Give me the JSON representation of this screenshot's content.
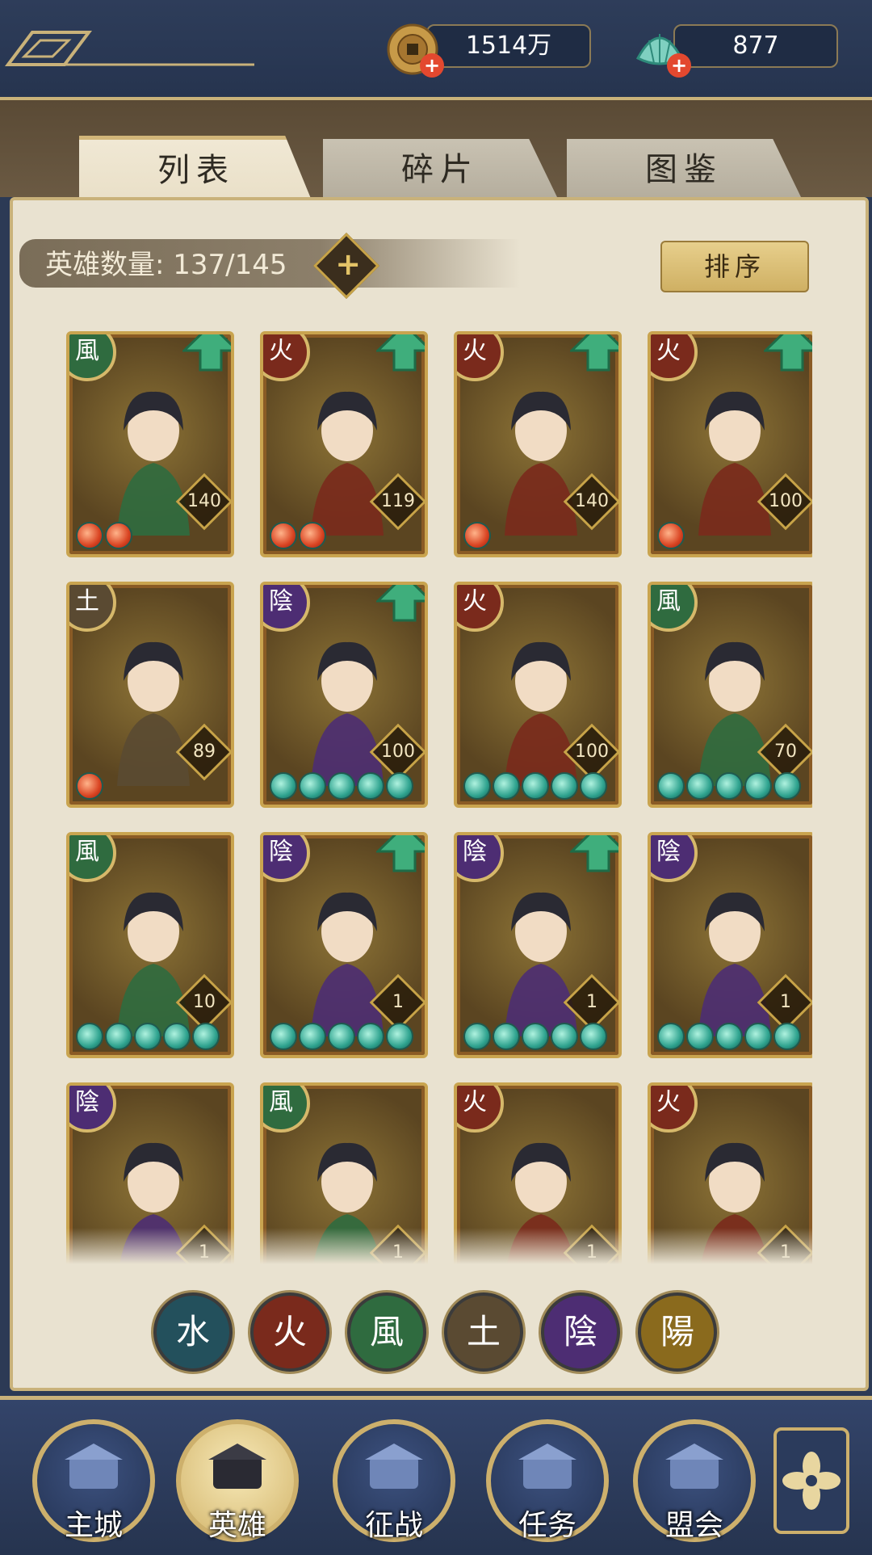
{
  "resources": {
    "coins": "1514万",
    "shells": "877"
  },
  "tabs": [
    {
      "label": "列表",
      "active": true
    },
    {
      "label": "碎片",
      "active": false
    },
    {
      "label": "图鉴",
      "active": false
    }
  ],
  "hero_count": "英雄数量: 137/145",
  "sort_label": "排序",
  "heroes": [
    {
      "element": "風",
      "level": "140",
      "upgrade": true,
      "orbs": "red",
      "orb_count": 2
    },
    {
      "element": "火",
      "level": "119",
      "upgrade": true,
      "orbs": "red",
      "orb_count": 2
    },
    {
      "element": "火",
      "level": "140",
      "upgrade": true,
      "orbs": "red",
      "orb_count": 1
    },
    {
      "element": "火",
      "level": "100",
      "upgrade": true,
      "orbs": "red",
      "orb_count": 1
    },
    {
      "element": "土",
      "level": "89",
      "upgrade": false,
      "orbs": "red",
      "orb_count": 1
    },
    {
      "element": "陰",
      "level": "100",
      "upgrade": true,
      "orbs": "teal",
      "orb_count": 5
    },
    {
      "element": "火",
      "level": "100",
      "upgrade": false,
      "orbs": "teal",
      "orb_count": 5
    },
    {
      "element": "風",
      "level": "70",
      "upgrade": false,
      "orbs": "teal",
      "orb_count": 5
    },
    {
      "element": "風",
      "level": "10",
      "upgrade": false,
      "orbs": "teal",
      "orb_count": 5
    },
    {
      "element": "陰",
      "level": "1",
      "upgrade": true,
      "orbs": "teal",
      "orb_count": 5
    },
    {
      "element": "陰",
      "level": "1",
      "upgrade": true,
      "orbs": "teal",
      "orb_count": 5
    },
    {
      "element": "陰",
      "level": "1",
      "upgrade": false,
      "orbs": "teal",
      "orb_count": 5
    },
    {
      "element": "陰",
      "level": "1",
      "upgrade": false,
      "orbs": "none",
      "orb_count": 0
    },
    {
      "element": "風",
      "level": "1",
      "upgrade": false,
      "orbs": "none",
      "orb_count": 0
    },
    {
      "element": "火",
      "level": "1",
      "upgrade": false,
      "orbs": "none",
      "orb_count": 0
    },
    {
      "element": "火",
      "level": "1",
      "upgrade": false,
      "orbs": "none",
      "orb_count": 0
    }
  ],
  "element_colors": {
    "風": "#2f6b3f",
    "火": "#7a2a1c",
    "土": "#5a4a32",
    "陰": "#4d2d73",
    "水": "#23505c",
    "陽": "#8a6a1d"
  },
  "filters": [
    {
      "glyph": "水",
      "color": "#23505c",
      "icon": "water-element-icon"
    },
    {
      "glyph": "火",
      "color": "#7a2a1c",
      "icon": "fire-element-icon"
    },
    {
      "glyph": "風",
      "color": "#2f6b3f",
      "icon": "wind-element-icon"
    },
    {
      "glyph": "土",
      "color": "#5a4a32",
      "icon": "earth-element-icon"
    },
    {
      "glyph": "陰",
      "color": "#4d2d73",
      "icon": "yin-element-icon"
    },
    {
      "glyph": "陽",
      "color": "#8a6a1d",
      "icon": "yang-element-icon"
    }
  ],
  "nav": [
    {
      "label": "主城",
      "icon": "city-gate-icon",
      "active": false
    },
    {
      "label": "英雄",
      "icon": "hero-portrait-icon",
      "active": true
    },
    {
      "label": "征战",
      "icon": "battle-horn-icon",
      "active": false
    },
    {
      "label": "任务",
      "icon": "task-scroll-icon",
      "active": false
    },
    {
      "label": "盟会",
      "icon": "guild-gate-icon",
      "active": false
    }
  ],
  "more_icon": "menu-flower-icon"
}
